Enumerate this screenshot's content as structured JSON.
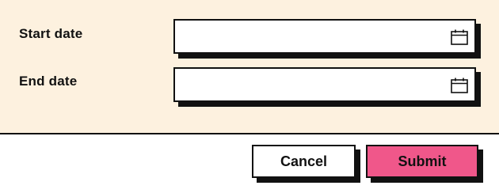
{
  "form": {
    "start_date": {
      "label": "Start date",
      "value": "",
      "icon": "calendar-icon"
    },
    "end_date": {
      "label": "End date",
      "value": "",
      "icon": "calendar-icon"
    }
  },
  "actions": {
    "cancel_label": "Cancel",
    "submit_label": "Submit"
  },
  "colors": {
    "panel_background": "#fdf1df",
    "submit_accent": "#f0578a",
    "border": "#111111"
  }
}
